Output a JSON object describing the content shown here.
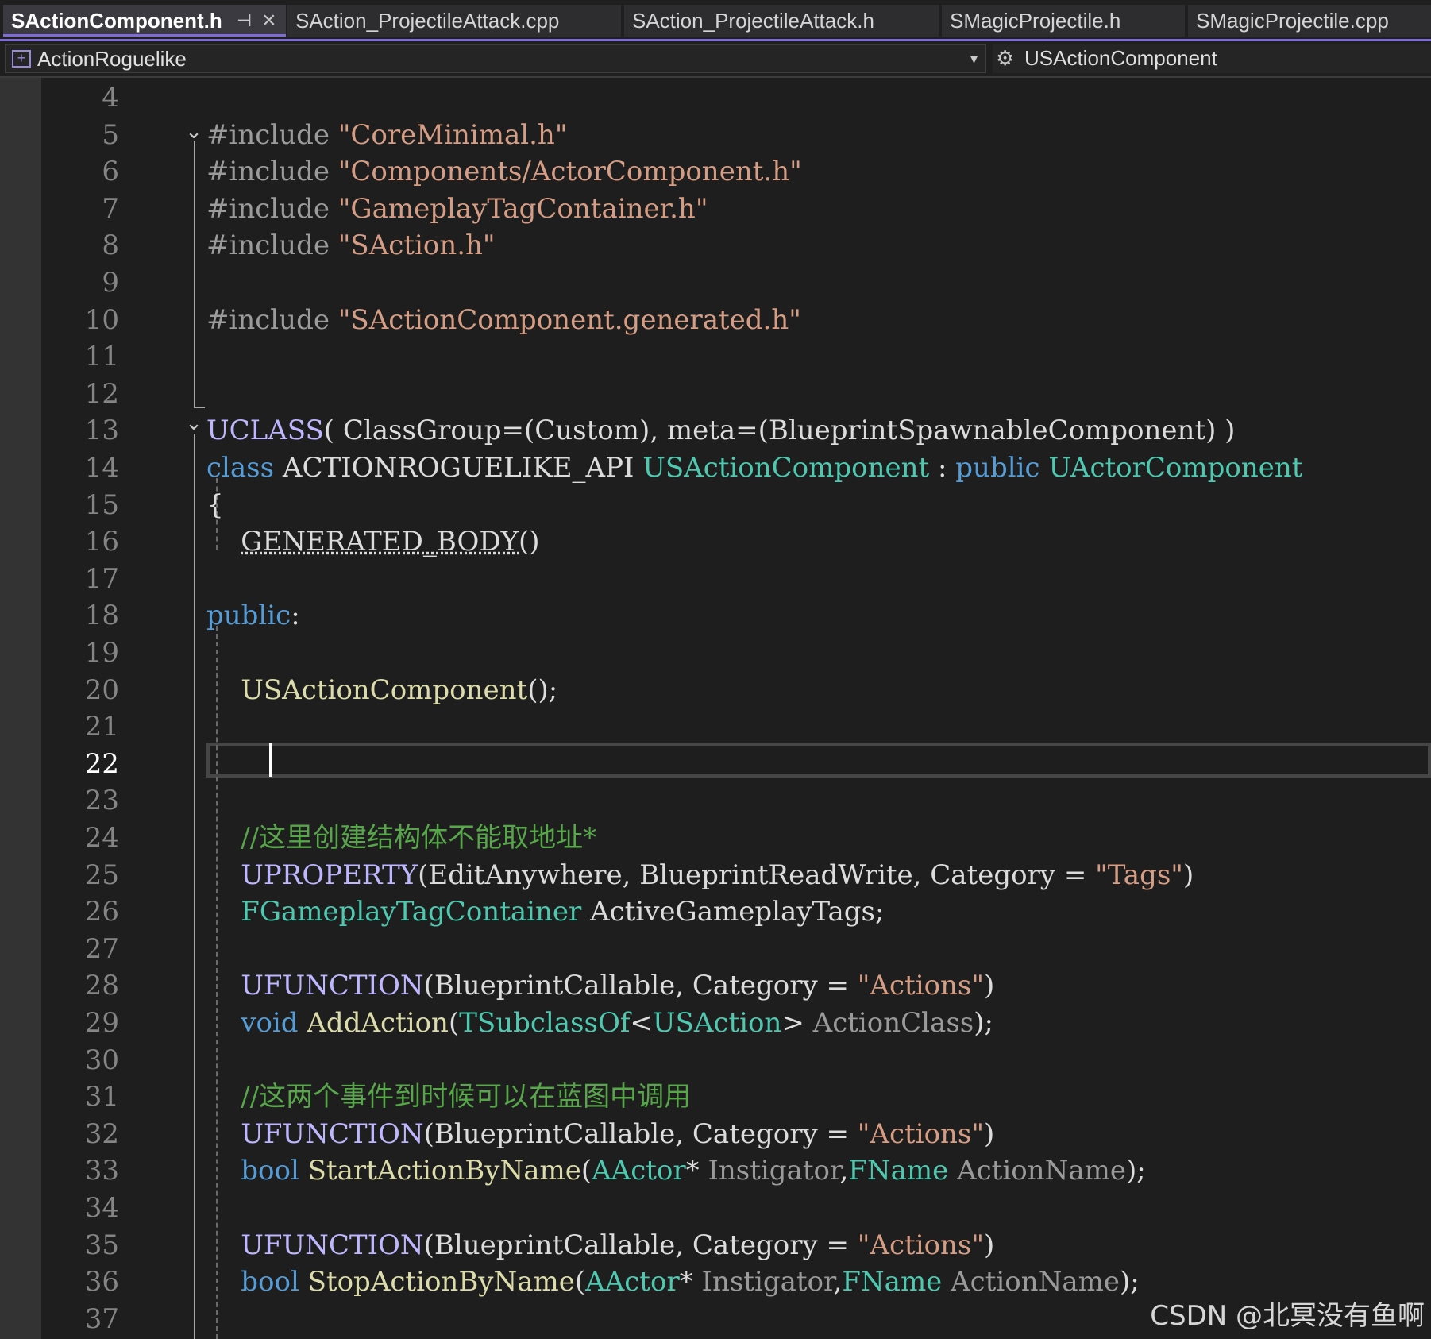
{
  "tabs": [
    {
      "label": "SActionComponent.h",
      "active": true
    },
    {
      "label": "SAction_ProjectileAttack.cpp",
      "active": false
    },
    {
      "label": "SAction_ProjectileAttack.h",
      "active": false
    },
    {
      "label": "SMagicProjectile.h",
      "active": false
    },
    {
      "label": "SMagicProjectile.cpp",
      "active": false
    }
  ],
  "tab_pin_glyph": "⊣",
  "tab_close_glyph": "×",
  "navbar": {
    "project": "ActionRoguelike",
    "project_icon": "project-icon",
    "dropdown_glyph": "▾",
    "class_name": "USActionComponent",
    "class_icon": "class-structure-icon"
  },
  "editor": {
    "current_line": 22,
    "line_numbers": [
      "4",
      "5",
      "6",
      "7",
      "8",
      "9",
      "10",
      "11",
      "12",
      "13",
      "14",
      "15",
      "16",
      "17",
      "18",
      "19",
      "20",
      "21",
      "22",
      "23",
      "24",
      "25",
      "26",
      "27",
      "28",
      "29",
      "30",
      "31",
      "32",
      "33",
      "34",
      "35",
      "36",
      "37"
    ],
    "lines": [
      [],
      [
        [
          "pp",
          "#include "
        ],
        [
          "str",
          "\"CoreMinimal.h\""
        ]
      ],
      [
        [
          "pp",
          "#include "
        ],
        [
          "str",
          "\"Components/ActorComponent.h\""
        ]
      ],
      [
        [
          "pp",
          "#include "
        ],
        [
          "str",
          "\"GameplayTagContainer.h\""
        ]
      ],
      [
        [
          "pp",
          "#include "
        ],
        [
          "str",
          "\"SAction.h\""
        ]
      ],
      [],
      [
        [
          "pp",
          "#include "
        ],
        [
          "str",
          "\"SActionComponent.generated.h\""
        ]
      ],
      [],
      [],
      [
        [
          "macro",
          "UCLASS"
        ],
        [
          "plain",
          "( ClassGroup=(Custom), meta=(BlueprintSpawnableComponent) )"
        ]
      ],
      [
        [
          "kw",
          "class"
        ],
        [
          "plain",
          " ACTIONROGUELIKE_API "
        ],
        [
          "type",
          "USActionComponent"
        ],
        [
          "plain",
          " : "
        ],
        [
          "kw",
          "public"
        ],
        [
          "plain",
          " "
        ],
        [
          "type",
          "UActorComponent"
        ]
      ],
      [
        [
          "plain",
          "{"
        ]
      ],
      [
        [
          "plain",
          "    "
        ],
        [
          "squig",
          "GENERATED_BODY"
        ],
        [
          "plain",
          "()"
        ]
      ],
      [],
      [
        [
          "kw",
          "public"
        ],
        [
          "plain",
          ":"
        ]
      ],
      [],
      [
        [
          "plain",
          "    "
        ],
        [
          "func",
          "USActionComponent"
        ],
        [
          "plain",
          "();"
        ]
      ],
      [],
      [],
      [],
      [
        [
          "plain",
          "    "
        ],
        [
          "cmt",
          "//这里创建结构体不能取地址*"
        ]
      ],
      [
        [
          "plain",
          "    "
        ],
        [
          "macro",
          "UPROPERTY"
        ],
        [
          "plain",
          "(EditAnywhere, BlueprintReadWrite, Category = "
        ],
        [
          "str",
          "\"Tags\""
        ],
        [
          "plain",
          ")"
        ]
      ],
      [
        [
          "plain",
          "    "
        ],
        [
          "type",
          "FGameplayTagContainer"
        ],
        [
          "plain",
          " ActiveGameplayTags;"
        ]
      ],
      [],
      [
        [
          "plain",
          "    "
        ],
        [
          "macro",
          "UFUNCTION"
        ],
        [
          "plain",
          "(BlueprintCallable, Category = "
        ],
        [
          "str",
          "\"Actions\""
        ],
        [
          "plain",
          ")"
        ]
      ],
      [
        [
          "plain",
          "    "
        ],
        [
          "kw",
          "void"
        ],
        [
          "plain",
          " "
        ],
        [
          "func",
          "AddAction"
        ],
        [
          "plain",
          "("
        ],
        [
          "type",
          "TSubclassOf"
        ],
        [
          "plain",
          "<"
        ],
        [
          "type",
          "USAction"
        ],
        [
          "plain",
          "> "
        ],
        [
          "param",
          "ActionClass"
        ],
        [
          "plain",
          ");"
        ]
      ],
      [],
      [
        [
          "plain",
          "    "
        ],
        [
          "cmt",
          "//这两个事件到时候可以在蓝图中调用"
        ]
      ],
      [
        [
          "plain",
          "    "
        ],
        [
          "macro",
          "UFUNCTION"
        ],
        [
          "plain",
          "(BlueprintCallable, Category = "
        ],
        [
          "str",
          "\"Actions\""
        ],
        [
          "plain",
          ")"
        ]
      ],
      [
        [
          "plain",
          "    "
        ],
        [
          "kw",
          "bool"
        ],
        [
          "plain",
          " "
        ],
        [
          "func",
          "StartActionByName"
        ],
        [
          "plain",
          "("
        ],
        [
          "type",
          "AActor"
        ],
        [
          "plain",
          "* "
        ],
        [
          "param",
          "Instigator"
        ],
        [
          "plain",
          ","
        ],
        [
          "type",
          "FName"
        ],
        [
          "plain",
          " "
        ],
        [
          "param",
          "ActionName"
        ],
        [
          "plain",
          ");"
        ]
      ],
      [],
      [
        [
          "plain",
          "    "
        ],
        [
          "macro",
          "UFUNCTION"
        ],
        [
          "plain",
          "(BlueprintCallable, Category = "
        ],
        [
          "str",
          "\"Actions\""
        ],
        [
          "plain",
          ")"
        ]
      ],
      [
        [
          "plain",
          "    "
        ],
        [
          "kw",
          "bool"
        ],
        [
          "plain",
          " "
        ],
        [
          "func",
          "StopActionByName"
        ],
        [
          "plain",
          "("
        ],
        [
          "type",
          "AActor"
        ],
        [
          "plain",
          "* "
        ],
        [
          "param",
          "Instigator"
        ],
        [
          "plain",
          ","
        ],
        [
          "type",
          "FName"
        ],
        [
          "plain",
          " "
        ],
        [
          "param",
          "ActionName"
        ],
        [
          "plain",
          ");"
        ]
      ],
      []
    ],
    "fold_glyph": "⌄"
  },
  "watermark": "CSDN @北冥没有鱼啊"
}
